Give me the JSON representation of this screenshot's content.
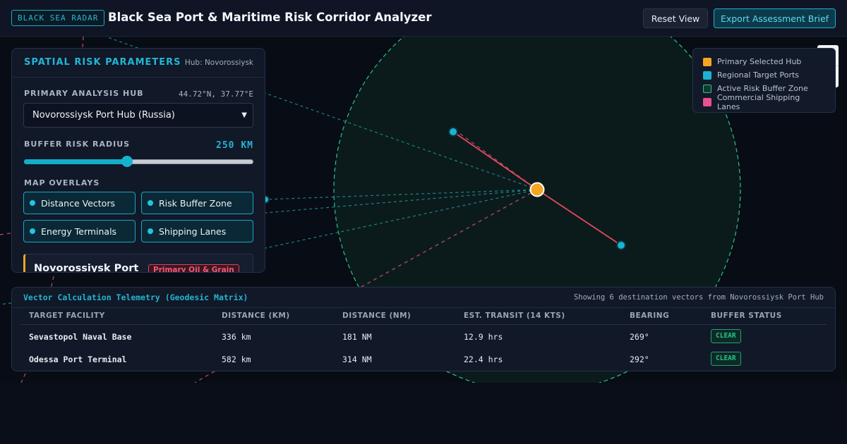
{
  "header": {
    "badge": "BLACK SEA RADAR",
    "title": "Black Sea Port & Maritime Risk Corridor Analyzer",
    "reset_label": "Reset View",
    "export_label": "Export Assessment Brief"
  },
  "legend": {
    "items": [
      {
        "label": "Primary Selected Hub",
        "color": "#f5a524"
      },
      {
        "label": "Regional Target Ports",
        "color": "#1bb3d3"
      },
      {
        "label": "Active Risk Buffer Zone",
        "color": "#0e3b2f"
      },
      {
        "label": "Commercial Shipping Lanes",
        "color": "#e8508e"
      }
    ]
  },
  "panel": {
    "title": "SPATIAL RISK PARAMETERS",
    "hub_caption": "Hub: Novorossiysk",
    "hub_label": "PRIMARY ANALYSIS HUB",
    "coords": "44.72°N, 37.77°E",
    "hub_selected": "Novorossiysk Port Hub (Russia)",
    "radius_label": "BUFFER RISK RADIUS",
    "radius_value": "250 KM",
    "radius_fraction": 0.45,
    "overlays_label": "MAP OVERLAYS",
    "overlays": [
      {
        "label": "Distance Vectors"
      },
      {
        "label": "Risk Buffer Zone"
      },
      {
        "label": "Energy Terminals"
      },
      {
        "label": "Shipping Lanes"
      }
    ],
    "card": {
      "name": "Novorossiysk Port",
      "badge": "Primary Oil & Grain"
    }
  },
  "telemetry": {
    "title": "Vector Calculation Telemetry (Geodesic Matrix)",
    "note": "Showing 6 destination vectors from Novorossiysk Port Hub",
    "columns": [
      "TARGET FACILITY",
      "DISTANCE (KM)",
      "DISTANCE (NM)",
      "EST. TRANSIT (14 KTS)",
      "BEARING",
      "BUFFER STATUS"
    ],
    "rows": [
      {
        "facility": "Sevastopol Naval Base",
        "km": "336 km",
        "nm": "181 NM",
        "transit": "12.9 hrs",
        "bearing": "269°",
        "status": "CLEAR"
      },
      {
        "facility": "Odessa Port Terminal",
        "km": "582 km",
        "nm": "314 NM",
        "transit": "22.4 hrs",
        "bearing": "292°",
        "status": "CLEAR"
      }
    ]
  },
  "map": {
    "hub_color": "#f5a524",
    "port_color": "#1bb3d3",
    "buffer_color": "#2fbf8f",
    "lane_color": "#e8508e",
    "vector_color": "#e8485e"
  }
}
